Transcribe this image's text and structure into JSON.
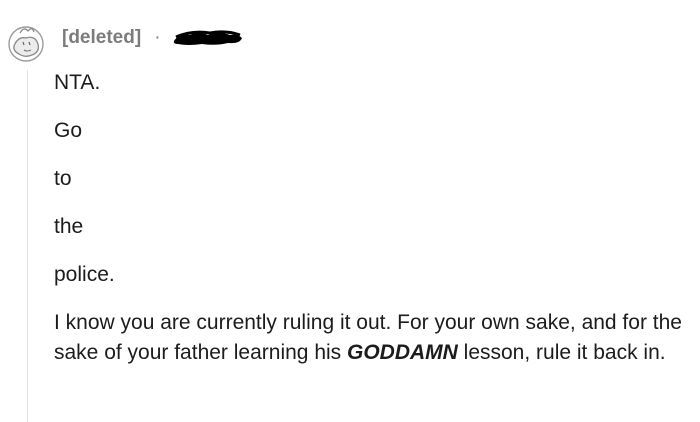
{
  "comment": {
    "author": "[deleted]",
    "separator": "·",
    "paragraphs": [
      "NTA.",
      "Go",
      "to",
      "the",
      "police."
    ],
    "final_paragraph": {
      "before": "I know you are currently ruling it out. For your own sake, and for the sake of your father learning his ",
      "emphasis": "GODDAMN",
      "after": " lesson, rule it back in."
    }
  },
  "icons": {
    "avatar": "deleted-user-avatar-icon",
    "redaction": "redacted-timestamp-scribble"
  },
  "colors": {
    "text": "#1c1c1c",
    "meta": "#7c7c7c",
    "thread_line": "#e3e3e3",
    "redaction": "#000000"
  }
}
